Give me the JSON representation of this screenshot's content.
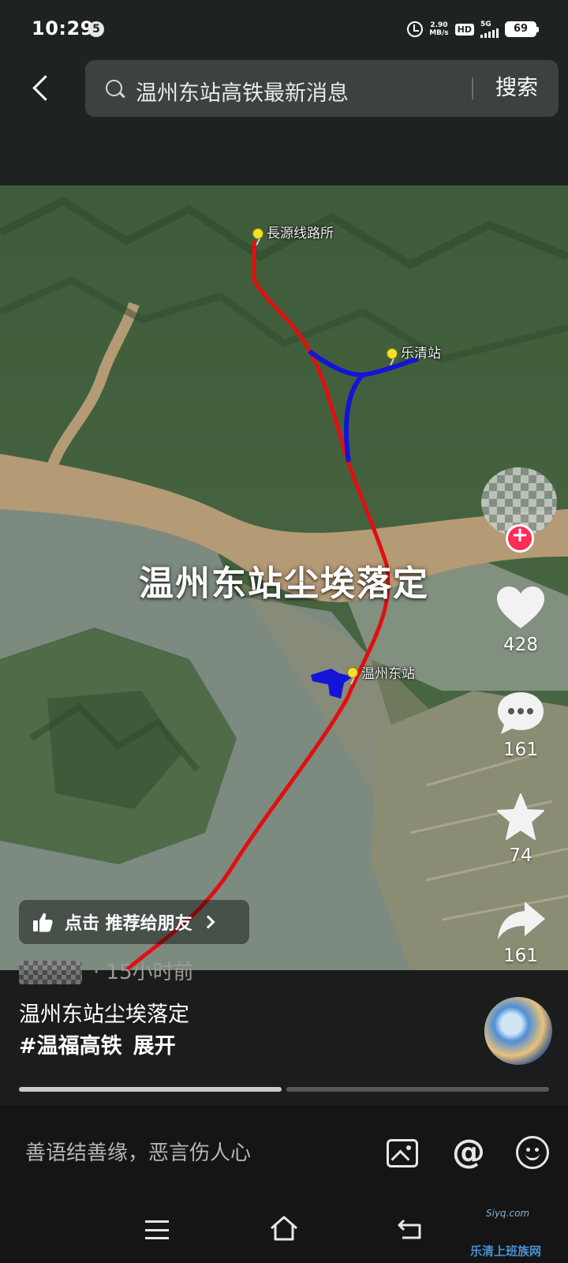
{
  "status_bar": {
    "time": "10:29",
    "notification_count": "5",
    "net_speed_value": "2.90",
    "net_speed_unit": "MB/s",
    "hd_label": "HD",
    "network_label": "5G",
    "battery": "69"
  },
  "search": {
    "query": "温州东站高铁最新消息",
    "button_label": "搜索"
  },
  "video": {
    "caption": "温州东站尘埃落定",
    "map_labels": [
      "長源线路所",
      "乐清站",
      "温州东站"
    ]
  },
  "actions": {
    "likes": "428",
    "comments": "161",
    "favorites": "74",
    "shares": "161"
  },
  "recommend": {
    "label": "点击 推荐给朋友"
  },
  "post": {
    "time": "· 15小时前",
    "title": "温州东站尘埃落定",
    "hashtag": "#温福高铁",
    "expand_label": "展开",
    "progress_segments": 2,
    "current_segment": 1
  },
  "comment_bar": {
    "placeholder": "善语结善缘，恶言伤人心",
    "mention_symbol": "@"
  },
  "watermark": {
    "logo": "Siyq.com",
    "text": "乐清上班族网"
  },
  "colors": {
    "accent_like": "#ff2c55",
    "route_main": "#e01010",
    "route_branch": "#1414d8"
  }
}
